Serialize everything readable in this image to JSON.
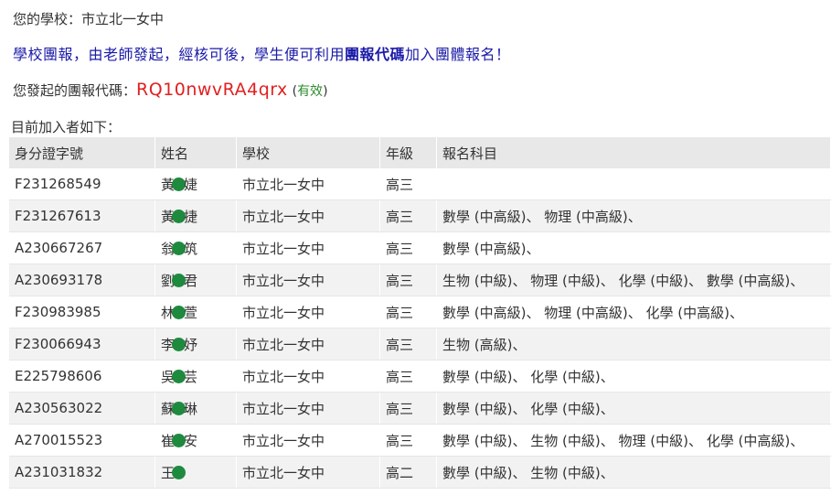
{
  "school_line": {
    "label": "您的學校：",
    "value": "市立北一女中"
  },
  "notice": {
    "before": "學校團報，由老師發起，經核可後，學生便可利用",
    "highlight": "團報代碼",
    "after": "加入團體報名！"
  },
  "group_code": {
    "label": "您發起的團報代碼：",
    "value": "RQ10nwvRA4qrx",
    "status": "有效"
  },
  "members_heading": "目前加入者如下：",
  "table": {
    "headers": [
      "身分證字號",
      "姓名",
      "學校",
      "年級",
      "報名科目"
    ],
    "rows": [
      {
        "id": "F231268549",
        "name_first": "黃",
        "name_last": "婕",
        "school": "市立北一女中",
        "grade": "高三",
        "subjects": ""
      },
      {
        "id": "F231267613",
        "name_first": "黃",
        "name_last": "捷",
        "school": "市立北一女中",
        "grade": "高三",
        "subjects": "數學 (中高級)、 物理 (中高級)、"
      },
      {
        "id": "A230667267",
        "name_first": "翁",
        "name_last": "筑",
        "school": "市立北一女中",
        "grade": "高三",
        "subjects": "數學 (中高級)、"
      },
      {
        "id": "A230693178",
        "name_first": "劉",
        "name_last": "君",
        "school": "市立北一女中",
        "grade": "高三",
        "subjects": "生物 (中級)、 物理 (中級)、 化學 (中級)、 數學 (中高級)、"
      },
      {
        "id": "F230983985",
        "name_first": "林",
        "name_last": "萱",
        "school": "市立北一女中",
        "grade": "高三",
        "subjects": "數學 (中高級)、 物理 (中高級)、 化學 (中高級)、"
      },
      {
        "id": "F230066943",
        "name_first": "李",
        "name_last": "妤",
        "school": "市立北一女中",
        "grade": "高三",
        "subjects": "生物 (高級)、"
      },
      {
        "id": "E225798606",
        "name_first": "吳",
        "name_last": "芸",
        "school": "市立北一女中",
        "grade": "高三",
        "subjects": "數學 (中級)、 化學 (中級)、"
      },
      {
        "id": "A230563022",
        "name_first": "蘇",
        "name_last": "琳",
        "school": "市立北一女中",
        "grade": "高三",
        "subjects": "數學 (中級)、 化學 (中級)、"
      },
      {
        "id": "A270015523",
        "name_first": "崔",
        "name_last": "安",
        "school": "市立北一女中",
        "grade": "高三",
        "subjects": "數學 (中級)、 生物 (中級)、 物理 (中級)、 化學 (中高級)、"
      },
      {
        "id": "A231031832",
        "name_first": "王",
        "name_last": "",
        "school": "市立北一女中",
        "grade": "高二",
        "subjects": "數學 (中級)、 生物 (中級)、"
      }
    ]
  },
  "colors": {
    "notice": "#1a1aa8",
    "code": "#e02020",
    "status": "#2e8b2e",
    "redaction": "#1e8a3e"
  }
}
